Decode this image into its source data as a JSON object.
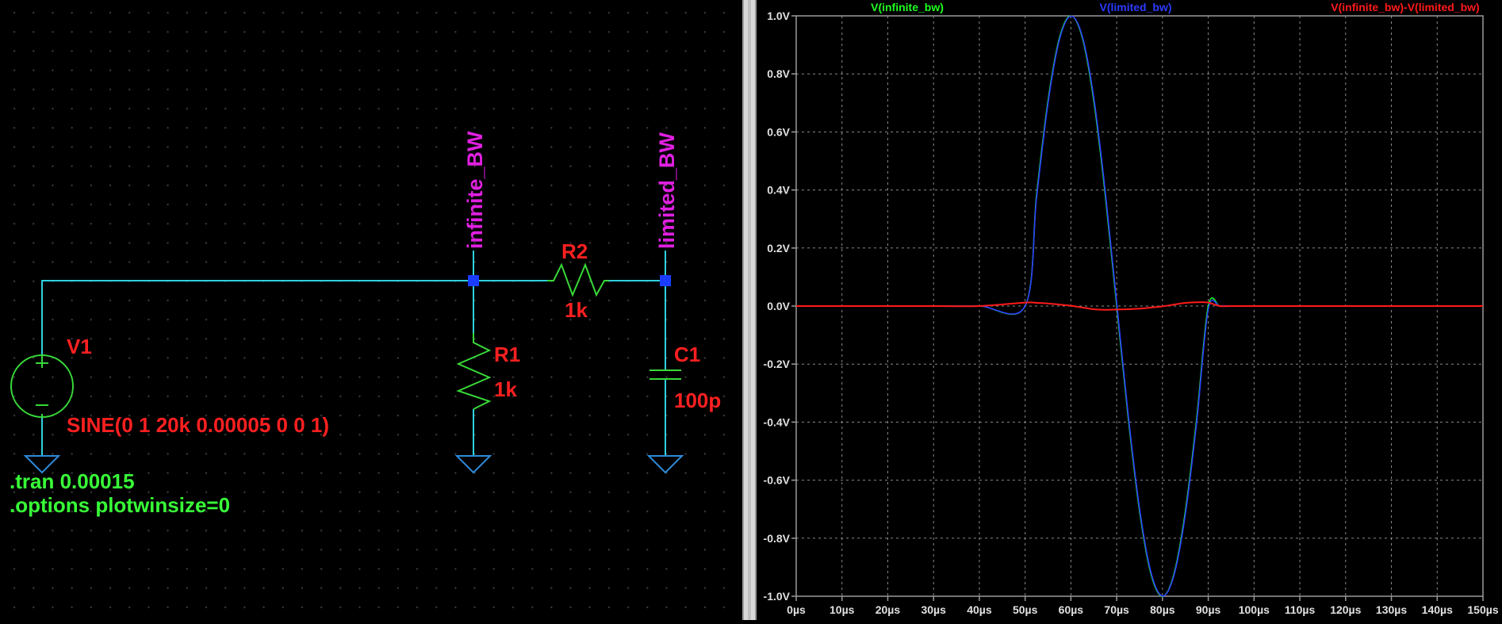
{
  "schematic": {
    "colors": {
      "wire": "#2fd0e0",
      "component": "#38d838",
      "label_red": "#ff2020",
      "net_label": "#e020e0",
      "directive": "#38ff38",
      "ground": "#2f8ad8",
      "node": "#1a3cff"
    },
    "net_labels": {
      "node1": "infinite_BW",
      "node2": "limited_BW"
    },
    "components": {
      "v1": {
        "name": "V1",
        "value": "SINE(0 1 20k 0.00005 0 0 1)",
        "icon": "sine-voltage-source-icon"
      },
      "r1": {
        "name": "R1",
        "value": "1k",
        "icon": "resistor-icon"
      },
      "r2": {
        "name": "R2",
        "value": "1k",
        "icon": "resistor-icon"
      },
      "c1": {
        "name": "C1",
        "value": "100p",
        "icon": "capacitor-icon"
      }
    },
    "directives": {
      "tran": ".tran 0.00015",
      "options": ".options plotwinsize=0"
    }
  },
  "chart_data": {
    "type": "line",
    "title": "",
    "xlabel": "",
    "ylabel": "",
    "xlim": [
      0,
      150
    ],
    "ylim": [
      -1.0,
      1.0
    ],
    "grid": true,
    "legend_position": "top",
    "x_ticks": [
      "0µs",
      "10µs",
      "20µs",
      "30µs",
      "40µs",
      "50µs",
      "60µs",
      "70µs",
      "80µs",
      "90µs",
      "100µs",
      "110µs",
      "120µs",
      "130µs",
      "140µs",
      "150µs"
    ],
    "y_ticks": [
      "1.0V",
      "0.8V",
      "0.6V",
      "0.4V",
      "0.2V",
      "0.0V",
      "-0.2V",
      "-0.4V",
      "-0.6V",
      "-0.8V",
      "-1.0V"
    ],
    "x": [
      0,
      10,
      20,
      30,
      40,
      50,
      52.5,
      55,
      57.5,
      60,
      62.5,
      65,
      67.5,
      70,
      72.5,
      75,
      77.5,
      80,
      82.5,
      85,
      87.5,
      90,
      92.5,
      95,
      97.5,
      100,
      110,
      120,
      130,
      140,
      150
    ],
    "series": [
      {
        "name": "V(infinite_bw)",
        "color": "#20ff20",
        "values": [
          0,
          0,
          0,
          0,
          0,
          0,
          0.383,
          0.707,
          0.924,
          1.0,
          0.924,
          0.707,
          0.383,
          0,
          -0.383,
          -0.707,
          -0.924,
          -1.0,
          -0.924,
          -0.707,
          -0.383,
          0,
          0,
          0,
          0,
          0,
          0,
          0,
          0,
          0,
          0
        ]
      },
      {
        "name": "V(limited_bw)",
        "color": "#2b3bff",
        "values": [
          0,
          0,
          0,
          0,
          0,
          0,
          0.372,
          0.698,
          0.918,
          0.999,
          0.929,
          0.718,
          0.396,
          0.012,
          -0.372,
          -0.698,
          -0.918,
          -0.999,
          -0.929,
          -0.718,
          -0.396,
          -0.012,
          0,
          0,
          0,
          0,
          0,
          0,
          0,
          0,
          0
        ]
      },
      {
        "name": "V(infinite_bw)-V(limited_bw)",
        "color": "#ff1a1a",
        "values": [
          0,
          0,
          0,
          0,
          0,
          0.012,
          0.011,
          0.009,
          0.005,
          0.001,
          -0.005,
          -0.011,
          -0.013,
          -0.012,
          -0.011,
          -0.009,
          -0.005,
          -0.001,
          0.005,
          0.011,
          0.013,
          0.012,
          0,
          0,
          0,
          0,
          0,
          0,
          0,
          0,
          0
        ]
      }
    ]
  }
}
